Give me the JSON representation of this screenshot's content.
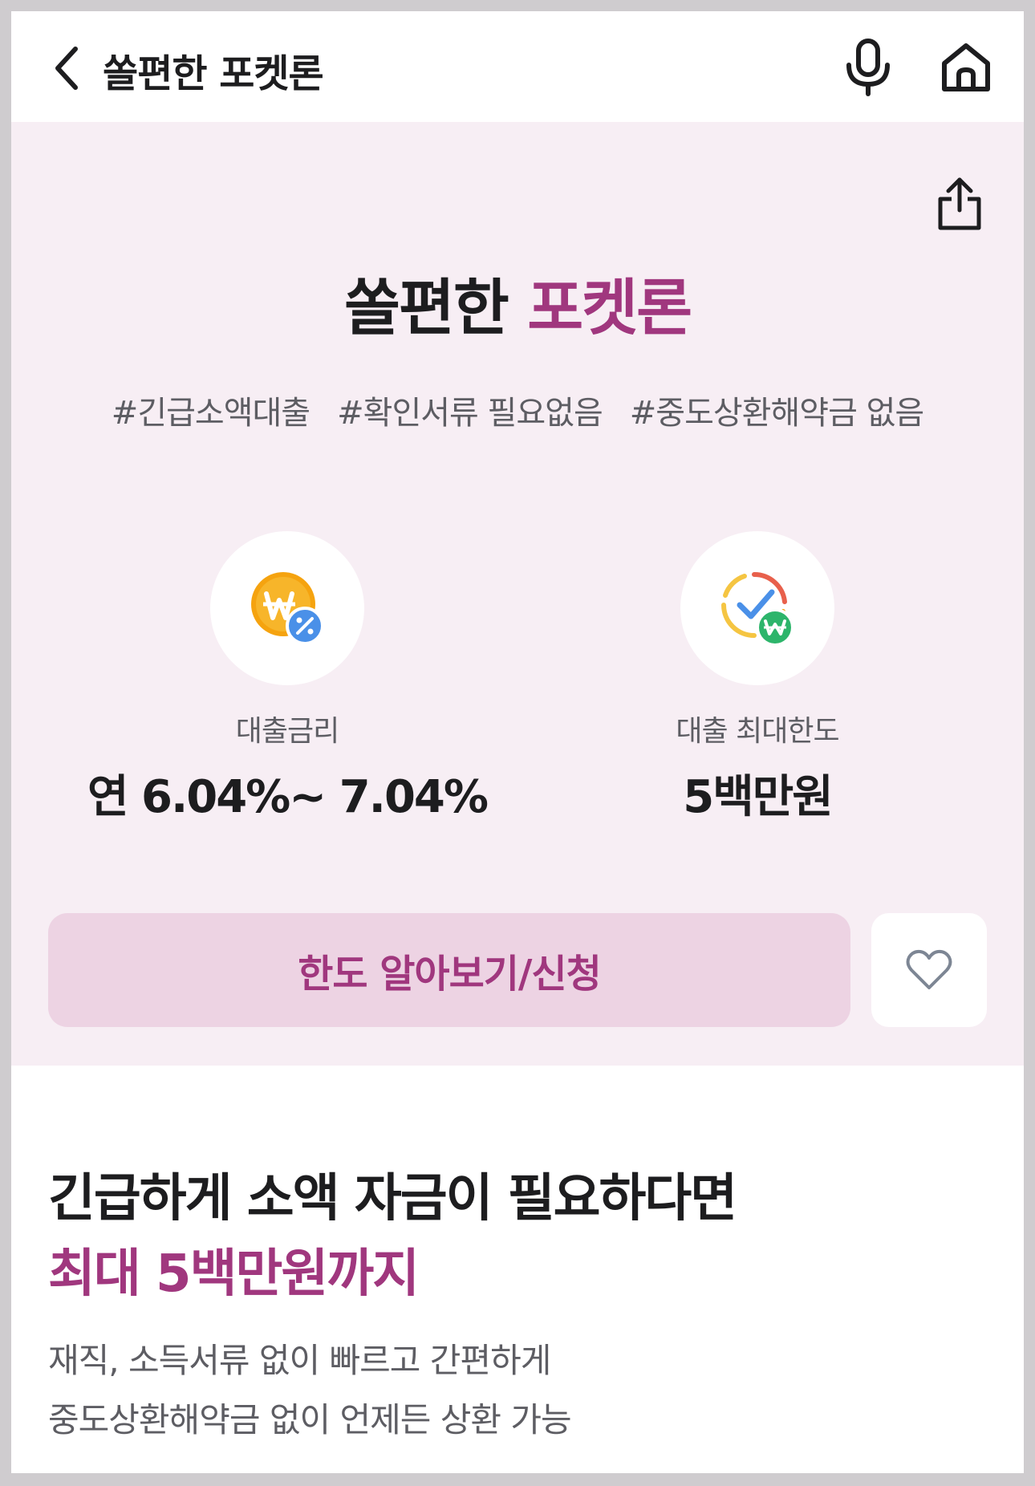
{
  "header": {
    "title": "쏠편한 포켓론",
    "back_icon": "chevron-left-icon",
    "mic_icon": "microphone-icon",
    "home_icon": "home-icon"
  },
  "hero": {
    "share_icon": "share-icon",
    "title_main": "쏠편한",
    "title_accent": "포켓론",
    "tags": [
      "#긴급소액대출",
      "#확인서류 필요없음",
      "#중도상환해약금 없음"
    ],
    "rate": {
      "icon": "won-percent-coin-icon",
      "label": "대출금리",
      "value": "연 6.04%~ 7.04%"
    },
    "limit": {
      "icon": "check-won-limit-icon",
      "label": "대출 최대한도",
      "value": "5백만원"
    },
    "apply_label": "한도 알아보기/신청",
    "favorite_icon": "heart-icon"
  },
  "content": {
    "headline": "긴급하게 소액 자금이 필요하다면",
    "headline_accent": "최대 5백만원까지",
    "desc_line1": "재직, 소득서류 없이 빠르고 간편하게",
    "desc_line2": "중도상환해약금 없이 언제든 상환 가능"
  },
  "colors": {
    "accent": "#a0377e",
    "hero_bg": "#f7eef4",
    "button_bg": "#edd3e3",
    "coin": "#f5a30f",
    "badge_blue": "#4a90e8",
    "badge_green": "#2db56b"
  }
}
